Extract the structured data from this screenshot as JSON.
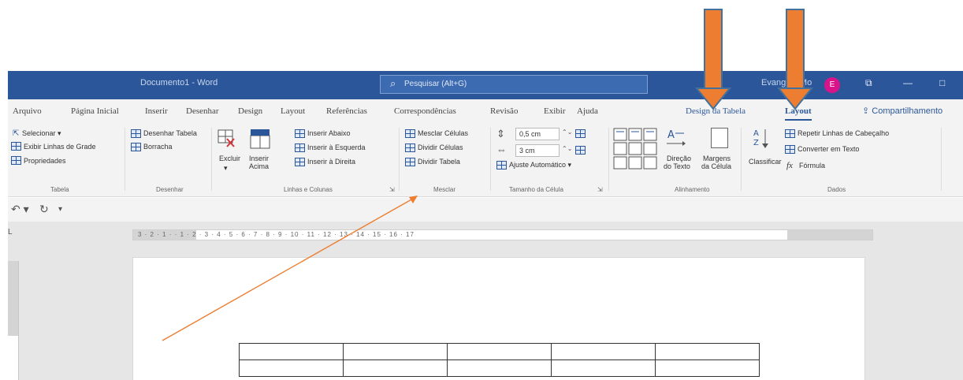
{
  "titlebar": {
    "doc_title": "Documento1 - Word",
    "search_placeholder": "Pesquisar (Alt+G)",
    "user_name": "Evangela Mo",
    "avatar_initial": "E",
    "restore_glyph": "⧉",
    "minimize_glyph": "—",
    "maximize_glyph": "□"
  },
  "tabs": [
    {
      "label": "Arquivo"
    },
    {
      "label": "Página Inicial"
    },
    {
      "label": "Inserir"
    },
    {
      "label": "Desenhar"
    },
    {
      "label": "Design"
    },
    {
      "label": "Layout"
    },
    {
      "label": "Referências"
    },
    {
      "label": "Correspondências"
    },
    {
      "label": "Revisão"
    },
    {
      "label": "Exibir"
    },
    {
      "label": "Ajuda"
    },
    {
      "label": "Design da Tabela"
    },
    {
      "label": "Layout"
    }
  ],
  "share_label": "Compartilhamento",
  "share_icon": "⇪",
  "ribbon": {
    "tabela": {
      "selecionar": "Selecionar ▾",
      "exibir_linhas": "Exibir Linhas de Grade",
      "propriedades": "Propriedades",
      "group": "Tabela"
    },
    "desenhar": {
      "desenhar_tabela": "Desenhar Tabela",
      "borracha": "Borracha",
      "group": "Desenhar"
    },
    "linhas_colunas": {
      "excluir": "Excluir",
      "excluir_caret": "▾",
      "inserir_acima_1": "Inserir",
      "inserir_acima_2": "Acima",
      "inserir_abaixo": "Inserir Abaixo",
      "inserir_esquerda": "Inserir à Esquerda",
      "inserir_direita": "Inserir à Direita",
      "group": "Linhas e Colunas",
      "launcher": "⇲"
    },
    "mesclar": {
      "mesclar_celulas": "Mesclar Células",
      "dividir_celulas": "Dividir Células",
      "dividir_tabela": "Dividir Tabela",
      "group": "Mesclar"
    },
    "tamanho": {
      "altura": "0,5 cm",
      "largura": "3 cm",
      "ajuste": "Ajuste Automático ▾",
      "group": "Tamanho da Célula",
      "launcher": "⇲",
      "spin": "⌃⌄"
    },
    "alinhamento": {
      "direcao_1": "Direção",
      "direcao_2": "do Texto",
      "margens_1": "Margens",
      "margens_2": "da Célula",
      "group": "Alinhamento"
    },
    "dados": {
      "classificar": "Classificar",
      "repetir": "Repetir Linhas de Cabeçalho",
      "converter": "Converter em Texto",
      "formula": "Fórmula",
      "fx": "fx",
      "group": "Dados"
    }
  },
  "qat": {
    "undo": "↶ ▾",
    "redo": "↻",
    "customize": "▾"
  },
  "ruler": {
    "tab_selector": "L",
    "numbers": "3 · 2 · 1 ·  · 1 · 2 · 3 · 4 · 5 · 6 · 7 · 8 · 9 · 10 · 11 · 12 · 13 · 14 · 15 · 16 · 17"
  },
  "colors": {
    "word_blue": "#2b579a",
    "arrow_orange": "#ed7d31"
  }
}
